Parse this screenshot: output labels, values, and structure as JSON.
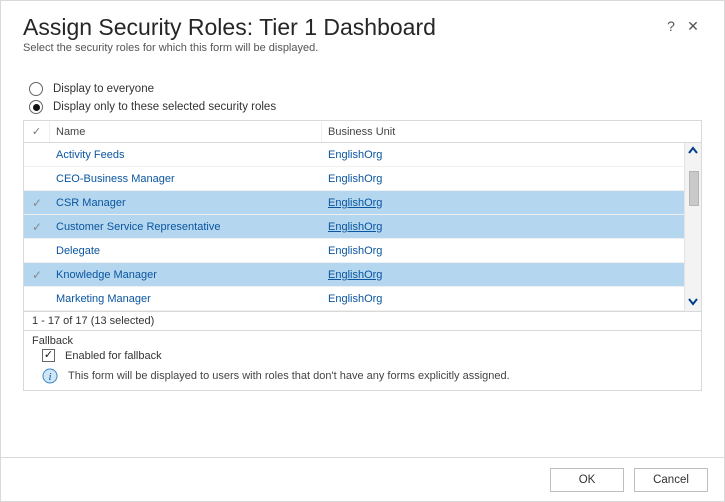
{
  "header": {
    "title": "Assign Security Roles: Tier 1 Dashboard",
    "subtitle": "Select the security roles for which this form will be displayed."
  },
  "radios": {
    "everyone": "Display to everyone",
    "selected": "Display only to these selected security roles"
  },
  "grid": {
    "columns": {
      "name": "Name",
      "bu": "Business Unit"
    },
    "rows": [
      {
        "name": "Activity Feeds",
        "bu": "EnglishOrg",
        "selected": false
      },
      {
        "name": "CEO-Business Manager",
        "bu": "EnglishOrg",
        "selected": false
      },
      {
        "name": "CSR Manager",
        "bu": "EnglishOrg",
        "selected": true
      },
      {
        "name": "Customer Service Representative",
        "bu": "EnglishOrg",
        "selected": true
      },
      {
        "name": "Delegate",
        "bu": "EnglishOrg",
        "selected": false
      },
      {
        "name": "Knowledge Manager",
        "bu": "EnglishOrg",
        "selected": true
      },
      {
        "name": "Marketing Manager",
        "bu": "EnglishOrg",
        "selected": false
      }
    ],
    "pager": "1 - 17 of 17 (13 selected)"
  },
  "fallback": {
    "section": "Fallback",
    "enabled_label": "Enabled for fallback",
    "info": "This form will be displayed to users with roles that don't have any forms explicitly assigned."
  },
  "footer": {
    "ok": "OK",
    "cancel": "Cancel"
  }
}
